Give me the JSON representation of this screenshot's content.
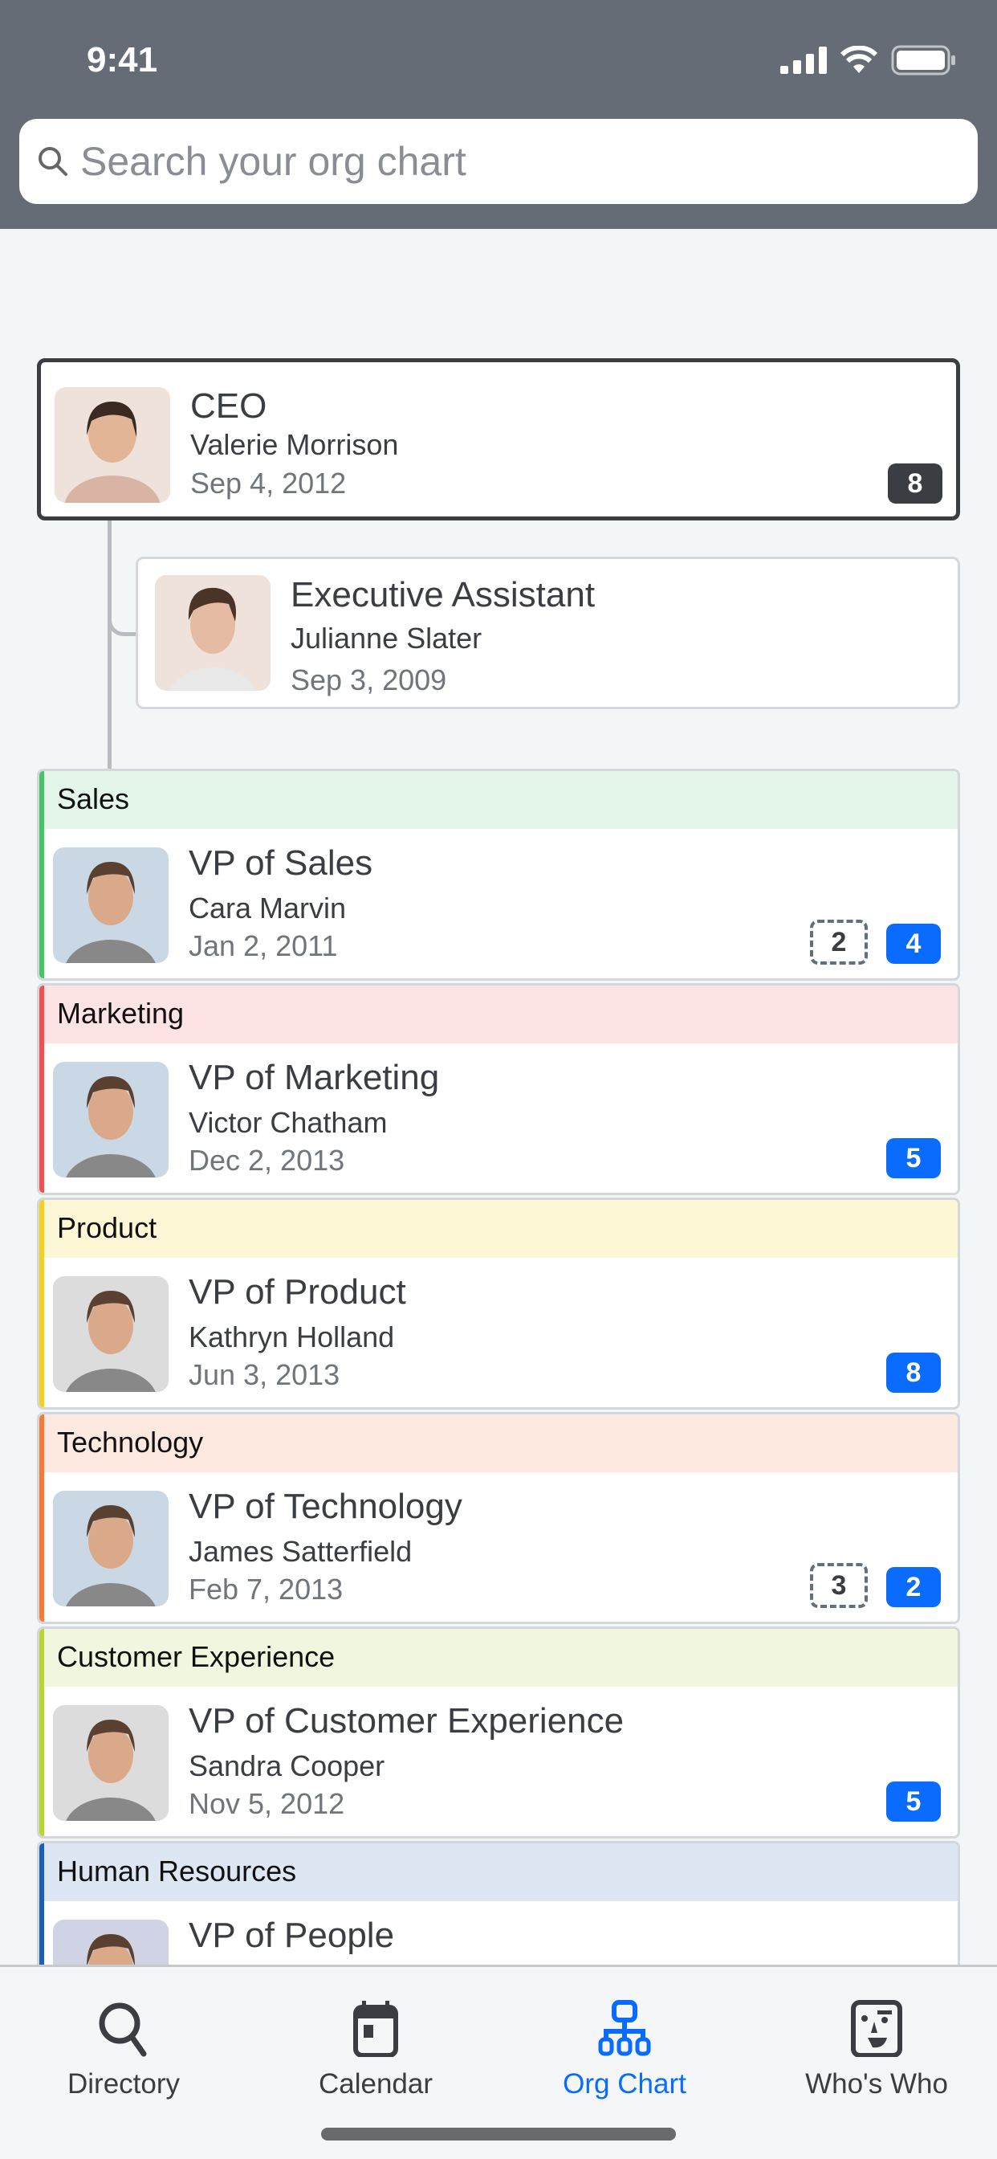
{
  "status": {
    "time": "9:41"
  },
  "search": {
    "placeholder": "Search your org chart"
  },
  "ceo": {
    "title": "CEO",
    "name": "Valerie Morrison",
    "date": "Sep 4, 2012",
    "reports": "8",
    "avatar_bg": "#efe2da"
  },
  "assistant": {
    "title": "Executive Assistant",
    "name": "Julianne Slater",
    "date": "Sep 3, 2009",
    "avatar_bg": "#efe2da"
  },
  "departments": [
    {
      "label": "Sales",
      "color": "#45c46a",
      "band": "#e4f5ea",
      "title": "VP of Sales",
      "name": "Cara Marvin",
      "date": "Jan 2, 2011",
      "open": "2",
      "reports": "4",
      "avatar_bg": "#c9d8e4"
    },
    {
      "label": "Marketing",
      "color": "#f0504f",
      "band": "#fde3e3",
      "title": "VP of Marketing",
      "name": "Victor Chatham",
      "date": "Dec 2, 2013",
      "reports": "5",
      "avatar_bg": "#c9d8e4"
    },
    {
      "label": "Product",
      "color": "#f5d01c",
      "band": "#fdf7d6",
      "title": "VP of Product",
      "name": "Kathryn Holland",
      "date": "Jun 3, 2013",
      "reports": "8",
      "avatar_bg": "#dcdcdc"
    },
    {
      "label": "Technology",
      "color": "#f4793a",
      "band": "#fde9e0",
      "title": "VP of Technology",
      "name": "James Satterfield",
      "date": "Feb 7, 2013",
      "open": "3",
      "reports": "2",
      "avatar_bg": "#c9d8e4"
    },
    {
      "label": "Customer Experience",
      "color": "#b9d530",
      "band": "#f1f7df",
      "title": "VP of Customer Experience",
      "name": "Sandra Cooper",
      "date": "Nov 5, 2012",
      "reports": "5",
      "avatar_bg": "#dcdcdc"
    },
    {
      "label": "Human Resources",
      "color": "#1a5fb4",
      "band": "#dce7f3",
      "title": "VP of People",
      "name": "",
      "date": "",
      "avatar_bg": "#cfd3e3"
    }
  ],
  "tabs": [
    {
      "label": "Directory",
      "icon": "search-icon"
    },
    {
      "label": "Calendar",
      "icon": "calendar-icon"
    },
    {
      "label": "Org Chart",
      "icon": "org-chart-icon",
      "active": true
    },
    {
      "label": "Who's Who",
      "icon": "face-icon"
    }
  ],
  "colors": {
    "accent": "#0a6cff",
    "header": "#656c75"
  }
}
